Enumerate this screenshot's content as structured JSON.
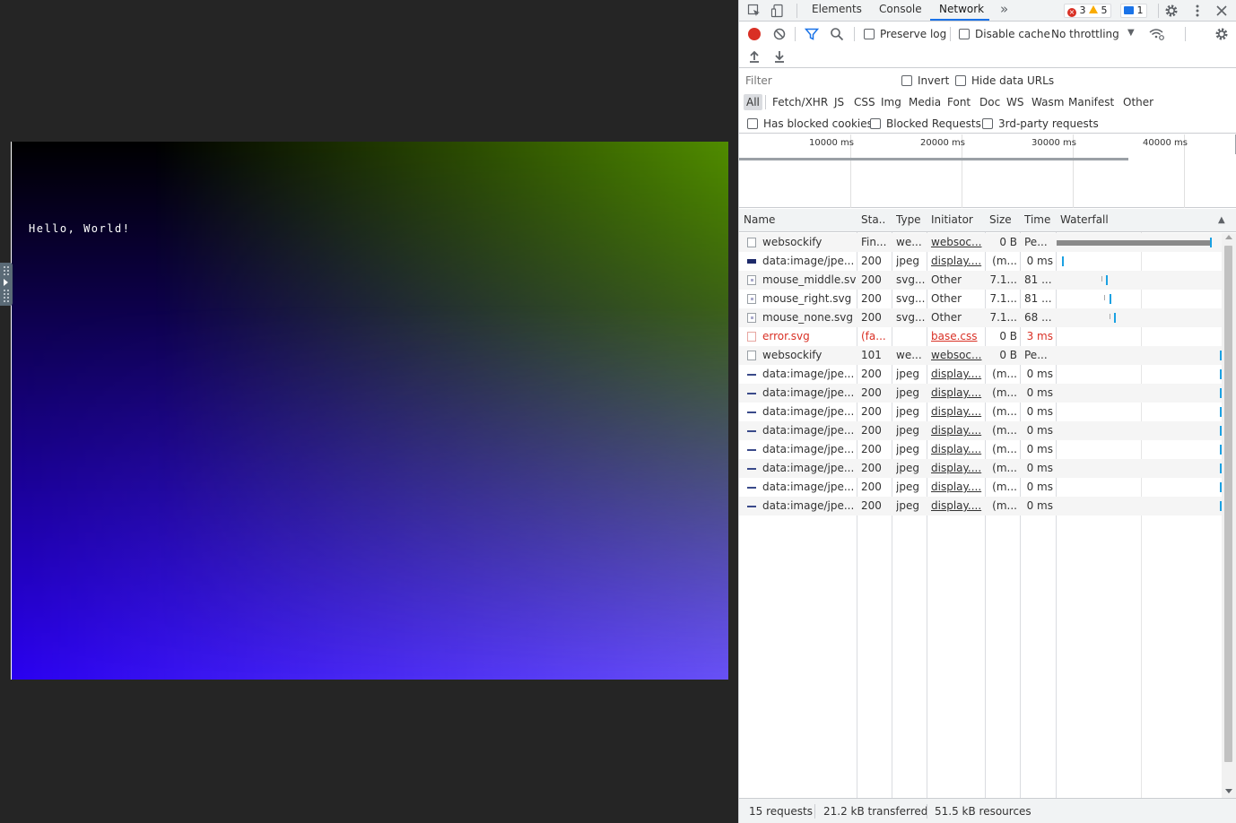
{
  "page": {
    "canvas_text": "Hello, World!"
  },
  "devtools": {
    "tabs": [
      "Elements",
      "Console",
      "Network"
    ],
    "active_tab": "Network",
    "more_tabs_glyph": "»",
    "badges": {
      "errors": "3",
      "warnings": "5",
      "messages": "1"
    },
    "toolbar": {
      "preserve_log": "Preserve log",
      "disable_cache": "Disable cache",
      "throttling": "No throttling"
    },
    "filter": {
      "placeholder": "Filter",
      "invert": "Invert",
      "hide_data_urls": "Hide data URLs",
      "types": [
        "All",
        "Fetch/XHR",
        "JS",
        "CSS",
        "Img",
        "Media",
        "Font",
        "Doc",
        "WS",
        "Wasm",
        "Manifest",
        "Other"
      ],
      "active_type": "All",
      "has_blocked_cookies": "Has blocked cookies",
      "blocked_requests": "Blocked Requests",
      "third_party": "3rd-party requests"
    },
    "overview": {
      "ticks": [
        "10000 ms",
        "20000 ms",
        "30000 ms",
        "40000 ms"
      ]
    },
    "table": {
      "columns": [
        "Name",
        "Sta..",
        "Type",
        "Initiator",
        "Size",
        "Time",
        "Waterfall"
      ],
      "rows": [
        {
          "name": "websockify",
          "status": "Fin...",
          "type": "we...",
          "initiator": "websoc...",
          "size": "0 B",
          "time": "Pe...",
          "icon": "doc",
          "link": true,
          "error": false,
          "wf_start": 0.0,
          "wf_end": 0.93
        },
        {
          "name": "data:image/jpe...",
          "status": "200",
          "type": "jpeg",
          "initiator": "display....",
          "size": "(m...",
          "time": "0 ms",
          "icon": "img-dark",
          "link": true,
          "error": false,
          "wf_start": 0.03,
          "wf_end": 0.03
        },
        {
          "name": "mouse_middle.svg",
          "status": "200",
          "type": "svg...",
          "initiator": "Other",
          "size": "7.1...",
          "time": "81 ...",
          "icon": "svg",
          "link": false,
          "error": false,
          "wf_start": 0.27,
          "wf_end": 0.3
        },
        {
          "name": "mouse_right.svg",
          "status": "200",
          "type": "svg...",
          "initiator": "Other",
          "size": "7.1...",
          "time": "81 ...",
          "icon": "svg",
          "link": false,
          "error": false,
          "wf_start": 0.29,
          "wf_end": 0.32
        },
        {
          "name": "mouse_none.svg",
          "status": "200",
          "type": "svg...",
          "initiator": "Other",
          "size": "7.1...",
          "time": "68 ...",
          "icon": "svg",
          "link": false,
          "error": false,
          "wf_start": 0.32,
          "wf_end": 0.35
        },
        {
          "name": "error.svg",
          "status": "(fa...",
          "type": "",
          "initiator": "base.css",
          "size": "0 B",
          "time": "3 ms",
          "icon": "err",
          "link": true,
          "error": true,
          "wf_start": null,
          "wf_end": null
        },
        {
          "name": "websockify",
          "status": "101",
          "type": "we...",
          "initiator": "websoc...",
          "size": "0 B",
          "time": "Pe...",
          "icon": "doc",
          "link": true,
          "error": false,
          "wf_start": 0.99,
          "wf_end": 0.99
        },
        {
          "name": "data:image/jpe...",
          "status": "200",
          "type": "jpeg",
          "initiator": "display....",
          "size": "(m...",
          "time": "0 ms",
          "icon": "img-line",
          "link": true,
          "error": false,
          "wf_start": 0.99,
          "wf_end": 0.99
        },
        {
          "name": "data:image/jpe...",
          "status": "200",
          "type": "jpeg",
          "initiator": "display....",
          "size": "(m...",
          "time": "0 ms",
          "icon": "img-line",
          "link": true,
          "error": false,
          "wf_start": 0.99,
          "wf_end": 0.99
        },
        {
          "name": "data:image/jpe...",
          "status": "200",
          "type": "jpeg",
          "initiator": "display....",
          "size": "(m...",
          "time": "0 ms",
          "icon": "img-line",
          "link": true,
          "error": false,
          "wf_start": 0.99,
          "wf_end": 0.99
        },
        {
          "name": "data:image/jpe...",
          "status": "200",
          "type": "jpeg",
          "initiator": "display....",
          "size": "(m...",
          "time": "0 ms",
          "icon": "img-line",
          "link": true,
          "error": false,
          "wf_start": 0.99,
          "wf_end": 0.99
        },
        {
          "name": "data:image/jpe...",
          "status": "200",
          "type": "jpeg",
          "initiator": "display....",
          "size": "(m...",
          "time": "0 ms",
          "icon": "img-line",
          "link": true,
          "error": false,
          "wf_start": 0.99,
          "wf_end": 0.99
        },
        {
          "name": "data:image/jpe...",
          "status": "200",
          "type": "jpeg",
          "initiator": "display....",
          "size": "(m...",
          "time": "0 ms",
          "icon": "img-line",
          "link": true,
          "error": false,
          "wf_start": 0.99,
          "wf_end": 0.99
        },
        {
          "name": "data:image/jpe...",
          "status": "200",
          "type": "jpeg",
          "initiator": "display....",
          "size": "(m...",
          "time": "0 ms",
          "icon": "img-line",
          "link": true,
          "error": false,
          "wf_start": 0.99,
          "wf_end": 0.99
        },
        {
          "name": "data:image/jpe...",
          "status": "200",
          "type": "jpeg",
          "initiator": "display....",
          "size": "(m...",
          "time": "0 ms",
          "icon": "img-line",
          "link": true,
          "error": false,
          "wf_start": 0.99,
          "wf_end": 0.99
        }
      ]
    },
    "status": {
      "requests": "15 requests",
      "transferred": "21.2 kB transferred",
      "resources": "51.5 kB resources"
    }
  }
}
